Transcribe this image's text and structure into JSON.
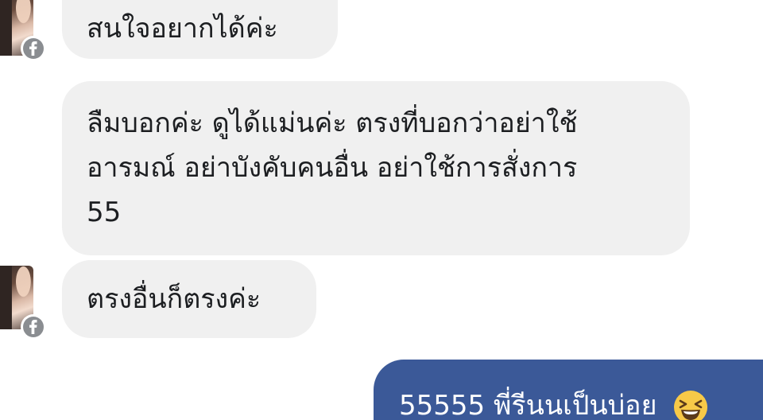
{
  "messages": [
    {
      "direction": "incoming",
      "text": "สนใจอยากได้ค่ะ",
      "show_avatar": true
    },
    {
      "direction": "incoming",
      "lines": [
        "ลืมบอกค่ะ ดูได้แม่นค่ะ ตรงที่บอกว่าอย่าใช้",
        "อารมณ์ อย่าบังคับคนอื่น อย่าใช้การสั่งการ",
        "55"
      ],
      "show_avatar": false
    },
    {
      "direction": "incoming",
      "text": "ตรงอื่นก็ตรงค่ะ",
      "show_avatar": true
    },
    {
      "direction": "outgoing",
      "text": "55555 พี่รีนนเป็นบ่อย",
      "emoji": "laughing-squinting-face-icon"
    }
  ],
  "colors": {
    "incoming_bubble": "#f0f0f0",
    "outgoing_bubble": "#3b5998",
    "badge": "#8a8d91"
  }
}
